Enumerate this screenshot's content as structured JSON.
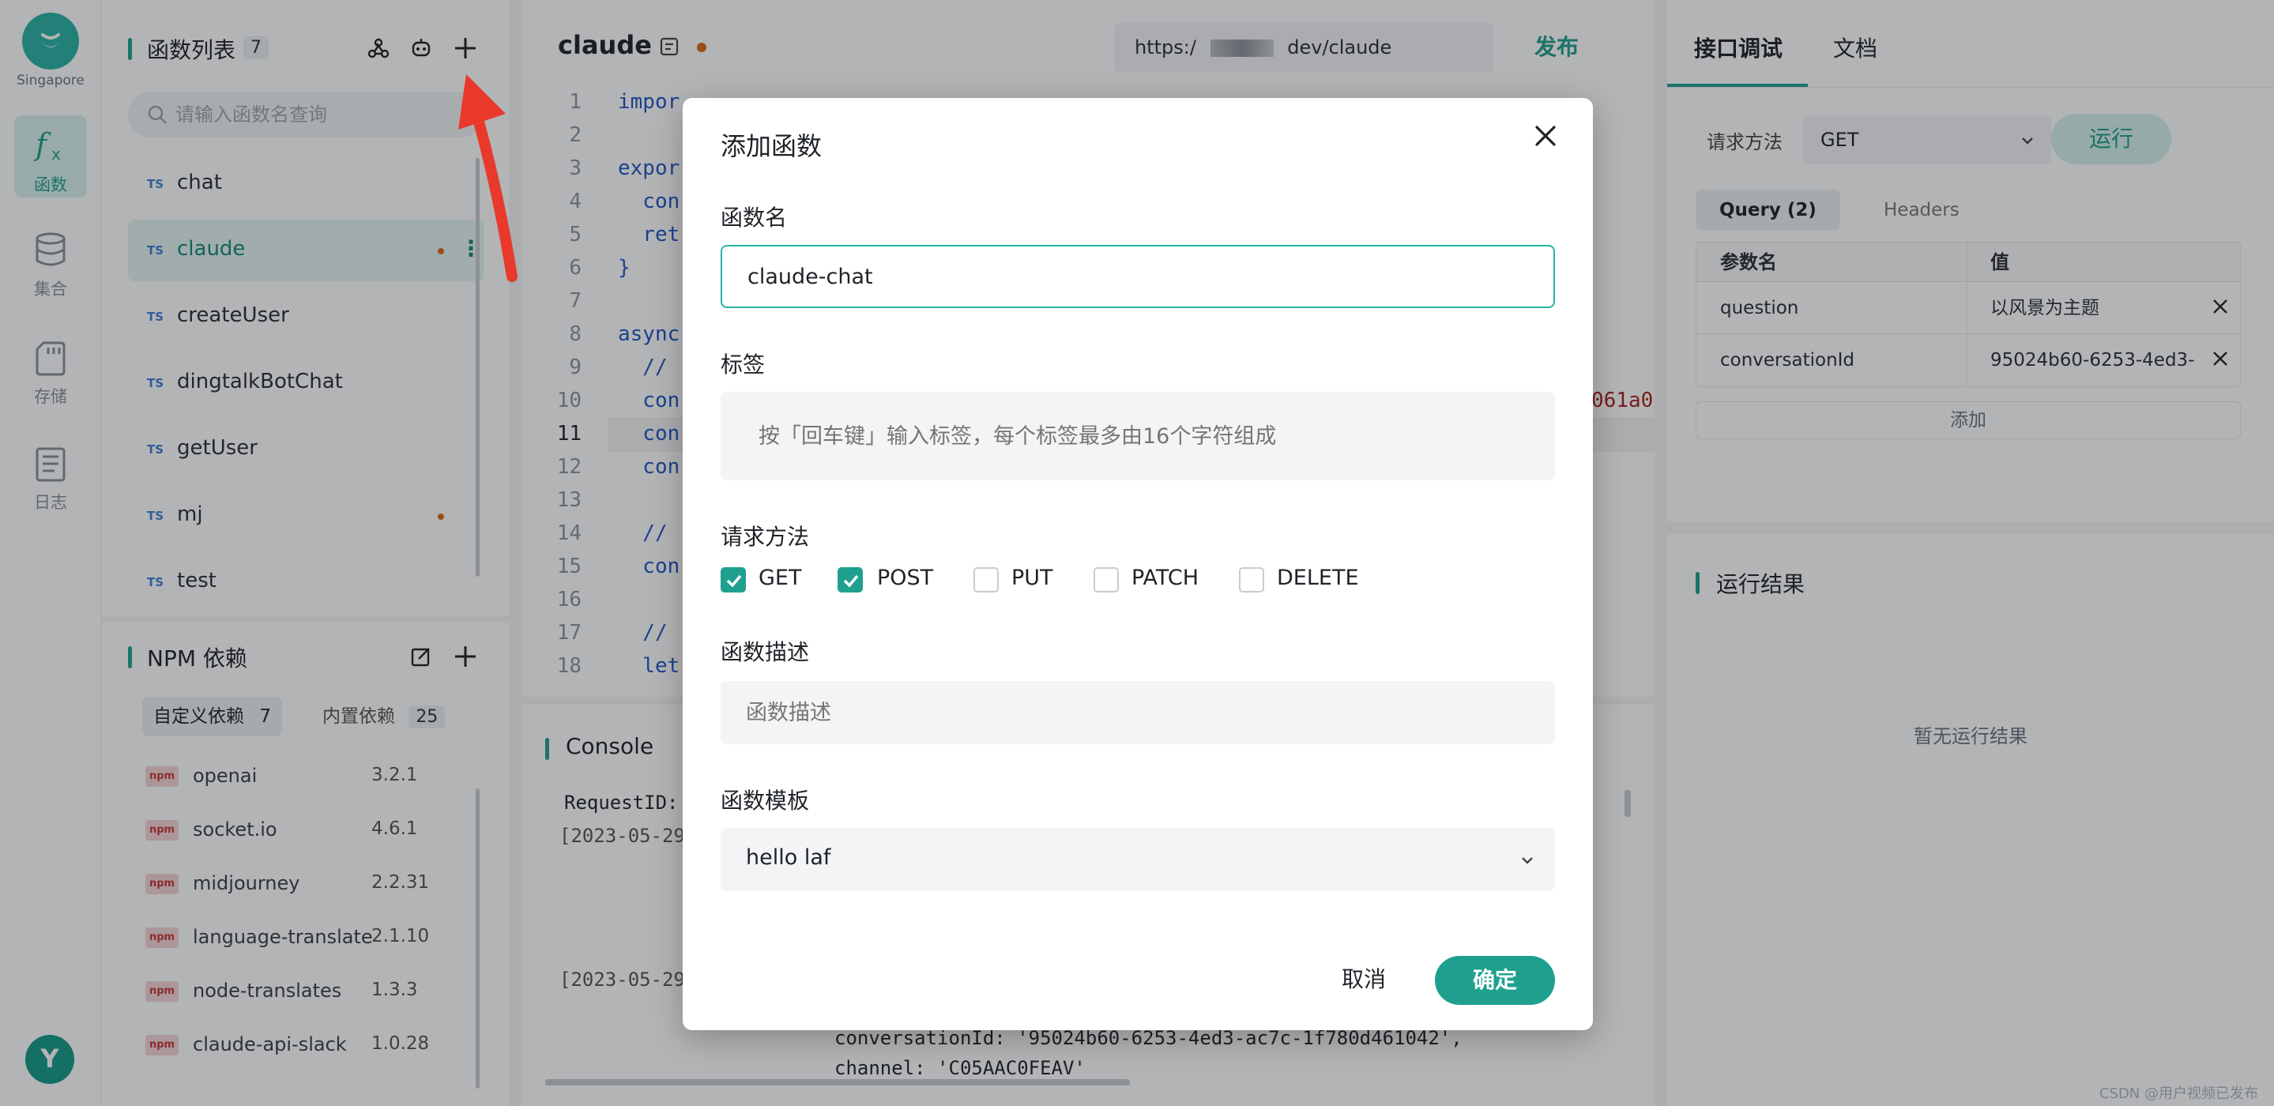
{
  "rail": {
    "region": "Singapore",
    "items": [
      {
        "label": "函数",
        "icon": "function-icon",
        "active": true
      },
      {
        "label": "集合",
        "icon": "database-icon",
        "active": false
      },
      {
        "label": "存储",
        "icon": "storage-card-icon",
        "active": false
      },
      {
        "label": "日志",
        "icon": "log-document-icon",
        "active": false
      }
    ]
  },
  "fnlist": {
    "title": "函数列表",
    "count": "7",
    "search_placeholder": "请输入函数名查询",
    "items": [
      {
        "tag": "TS",
        "name": "chat"
      },
      {
        "tag": "TS",
        "name": "claude"
      },
      {
        "tag": "TS",
        "name": "createUser"
      },
      {
        "tag": "TS",
        "name": "dingtalkBotChat"
      },
      {
        "tag": "TS",
        "name": "getUser"
      },
      {
        "tag": "TS",
        "name": "mj"
      },
      {
        "tag": "TS",
        "name": "test"
      }
    ]
  },
  "npm": {
    "title": "NPM 依赖",
    "tab_custom": "自定义依赖",
    "tab_custom_count": "7",
    "tab_builtin": "内置依赖",
    "tab_builtin_count": "25",
    "packages": [
      {
        "name": "openai",
        "version": "3.2.1"
      },
      {
        "name": "socket.io",
        "version": "4.6.1"
      },
      {
        "name": "midjourney",
        "version": "2.2.31"
      },
      {
        "name": "language-translate",
        "version": "2.1.10"
      },
      {
        "name": "node-translates",
        "version": "1.3.3"
      },
      {
        "name": "claude-api-slack",
        "version": "1.0.28"
      }
    ],
    "npm_badge": "npm"
  },
  "editor": {
    "title": "claude",
    "url_prefix": "https:/",
    "url_suffix": "dev/claude",
    "publish": "发布",
    "lines": [
      "1",
      "2",
      "3",
      "4",
      "5",
      "6",
      "7",
      "8",
      "9",
      "10",
      "11",
      "12",
      "13",
      "14",
      "15",
      "16",
      "17",
      "18"
    ],
    "current_line": "11",
    "code": [
      {
        "line": 1,
        "text": "impor"
      },
      {
        "line": 3,
        "text": "expor"
      },
      {
        "line": 4,
        "text": "  con"
      },
      {
        "line": 5,
        "text": "  ret"
      },
      {
        "line": 6,
        "text": "}"
      },
      {
        "line": 8,
        "text": "async"
      },
      {
        "line": 9,
        "text": "  //"
      },
      {
        "line": 10,
        "text": "  con"
      },
      {
        "line": 11,
        "text": "  con"
      },
      {
        "line": 12,
        "text": "  con"
      },
      {
        "line": 14,
        "text": "  //"
      },
      {
        "line": 15,
        "text": "  con"
      },
      {
        "line": 17,
        "text": "  //"
      },
      {
        "line": 18,
        "text": "  let"
      }
    ],
    "right_fragment": "061a0"
  },
  "console": {
    "title": "Console",
    "request_id": "RequestID:",
    "log1": "[2023-05-29",
    "log2": "[2023-05-29",
    "conv_line": "conversationId: '95024b60-6253-4ed3-ac7c-1f780d461042',",
    "channel_line": "channel: 'C05AAC0FEAV'"
  },
  "right": {
    "tab_debug": "接口调试",
    "tab_docs": "文档",
    "method_label": "请求方法",
    "method_value": "GET",
    "run": "运行",
    "subtab_query": "Query (2)",
    "subtab_headers": "Headers",
    "col_name": "参数名",
    "col_value": "值",
    "params": [
      {
        "name": "question",
        "value": "以风景为主题"
      },
      {
        "name": "conversationId",
        "value": "95024b60-6253-4ed3-"
      }
    ],
    "add": "添加",
    "result_title": "运行结果",
    "result_empty": "暂无运行结果"
  },
  "modal": {
    "title": "添加函数",
    "name_label": "函数名",
    "name_value": "claude-chat",
    "tag_label": "标签",
    "tag_placeholder": "按「回车键」输入标签，每个标签最多由16个字符组成",
    "method_label": "请求方法",
    "methods": [
      {
        "label": "GET",
        "checked": true
      },
      {
        "label": "POST",
        "checked": true
      },
      {
        "label": "PUT",
        "checked": false
      },
      {
        "label": "PATCH",
        "checked": false
      },
      {
        "label": "DELETE",
        "checked": false
      }
    ],
    "desc_label": "函数描述",
    "desc_placeholder": "函数描述",
    "template_label": "函数模板",
    "template_value": "hello laf",
    "cancel": "取消",
    "ok": "确定"
  },
  "watermark": "CSDN @用户视频已发布",
  "colors": {
    "accent": "#1fa08f",
    "arrow": "#e8392b",
    "modified_dot": "#d9691b"
  }
}
